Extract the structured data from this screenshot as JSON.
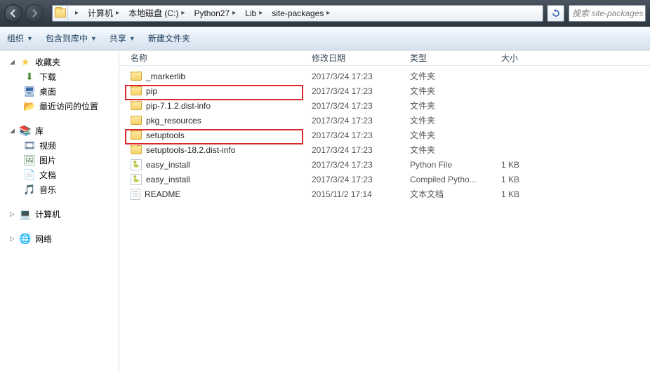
{
  "breadcrumb": [
    "计算机",
    "本地磁盘 (C:)",
    "Python27",
    "Lib",
    "site-packages"
  ],
  "search_placeholder": "搜索 site-packages",
  "toolbar": {
    "organize": "组织",
    "include": "包含到库中",
    "share": "共享",
    "newfolder": "新建文件夹"
  },
  "sidebar": {
    "favorites": {
      "label": "收藏夹",
      "items": [
        {
          "key": "downloads",
          "label": "下载"
        },
        {
          "key": "desktop",
          "label": "桌面"
        },
        {
          "key": "recent",
          "label": "最近访问的位置"
        }
      ]
    },
    "libraries": {
      "label": "库",
      "items": [
        {
          "key": "videos",
          "label": "视频"
        },
        {
          "key": "pictures",
          "label": "图片"
        },
        {
          "key": "documents",
          "label": "文档"
        },
        {
          "key": "music",
          "label": "音乐"
        }
      ]
    },
    "computer": {
      "label": "计算机"
    },
    "network": {
      "label": "网络"
    }
  },
  "columns": {
    "name": "名称",
    "date": "修改日期",
    "type": "类型",
    "size": "大小"
  },
  "files": [
    {
      "icon": "folder",
      "name": "_markerlib",
      "date": "2017/3/24 17:23",
      "type": "文件夹",
      "size": ""
    },
    {
      "icon": "folder",
      "name": "pip",
      "date": "2017/3/24 17:23",
      "type": "文件夹",
      "size": ""
    },
    {
      "icon": "folder",
      "name": "pip-7.1.2.dist-info",
      "date": "2017/3/24 17:23",
      "type": "文件夹",
      "size": ""
    },
    {
      "icon": "folder",
      "name": "pkg_resources",
      "date": "2017/3/24 17:23",
      "type": "文件夹",
      "size": ""
    },
    {
      "icon": "folder",
      "name": "setuptools",
      "date": "2017/3/24 17:23",
      "type": "文件夹",
      "size": ""
    },
    {
      "icon": "folder",
      "name": "setuptools-18.2.dist-info",
      "date": "2017/3/24 17:23",
      "type": "文件夹",
      "size": ""
    },
    {
      "icon": "py",
      "name": "easy_install",
      "date": "2017/3/24 17:23",
      "type": "Python File",
      "size": "1 KB"
    },
    {
      "icon": "py",
      "name": "easy_install",
      "date": "2017/3/24 17:23",
      "type": "Compiled Pytho...",
      "size": "1 KB"
    },
    {
      "icon": "txt",
      "name": "README",
      "date": "2015/11/2 17:14",
      "type": "文本文档",
      "size": "1 KB"
    }
  ]
}
